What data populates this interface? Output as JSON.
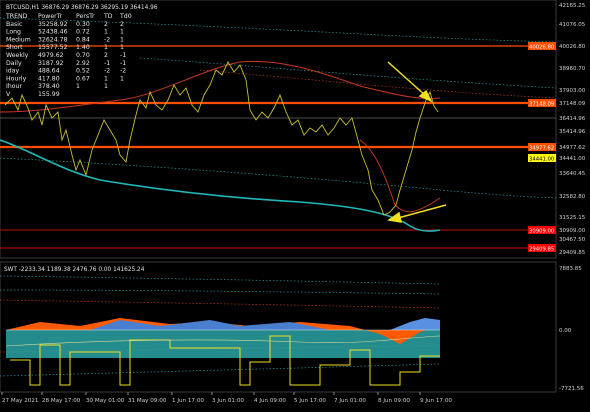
{
  "chart_header": {
    "symbol_line": "BTCUSD,H1  36876.29 36876.29 36295.19 36414.96"
  },
  "trend_table": {
    "headers": [
      "TREND",
      "PowerTr",
      "PersTr",
      "TD",
      "Td0"
    ],
    "rows": [
      [
        "Basic",
        "35258.92",
        "0.30",
        "2",
        "2"
      ],
      [
        "Long",
        "52438.46",
        "0.72",
        "1",
        "1"
      ],
      [
        "Medium",
        "32624.78",
        "0.84",
        "-2",
        "1"
      ],
      [
        "Short",
        "15577.52",
        "1.40",
        "1",
        "1"
      ],
      [
        "Weekly",
        "4979.62",
        "0.70",
        "2",
        "-1"
      ],
      [
        "Daily",
        "3187.92",
        "2.92",
        "-1",
        "-1"
      ],
      [
        "iday",
        "488.64",
        "0.52",
        "-2",
        "-2"
      ],
      [
        "Hourly",
        "417.80",
        "0.67",
        "1",
        "1"
      ],
      [
        "Ihour",
        "378.40",
        "1",
        "1",
        ""
      ],
      [
        "V",
        "155.99",
        "",
        "",
        ""
      ]
    ]
  },
  "price_axis": {
    "ticks": [
      "42165.25",
      "41076.05",
      "40026.80",
      "38960.70",
      "37903.00",
      "37148.09",
      "36414.96",
      "35414.96",
      "34977.62",
      "34441.00",
      "33640.45",
      "32582.80",
      "31525.15",
      "30909.00",
      "30467.50",
      "29409.85"
    ]
  },
  "price_levels": [
    {
      "label": "40026.80",
      "color": "#ff4d00"
    },
    {
      "label": "37148.09",
      "color": "#ff4d00"
    },
    {
      "label": "34977.62",
      "color": "#ff4d00"
    },
    {
      "label": "34441.00",
      "color": "#ffff00"
    },
    {
      "label": "30909.00",
      "color": "#ff0000"
    },
    {
      "label": "29409.85",
      "color": "#ff0000"
    }
  ],
  "indicator": {
    "title": "SWT -2233.34 1189.38 2476.76 0.00 141625.24",
    "axis_labels": [
      "7883.85",
      "0.00",
      "-7721.56"
    ]
  },
  "time_axis": {
    "labels": [
      "27 May 2021",
      "28 May 17:00",
      "30 May 01:00",
      "31 May 09:00",
      "1 Jun 17:00",
      "3 Jun 01:00",
      "4 Jun 09:00",
      "5 Jun 17:00",
      "7 Jun 01:00",
      "8 Jun 09:00",
      "9 Jun 17:00"
    ]
  },
  "colors": {
    "background": "#000000",
    "price_line": "#c8c030",
    "ma_cyan": "#1fb8b8",
    "ma_red": "#c83820",
    "level_orange": "#ff4d00",
    "arrow_yellow": "#f0e020"
  }
}
